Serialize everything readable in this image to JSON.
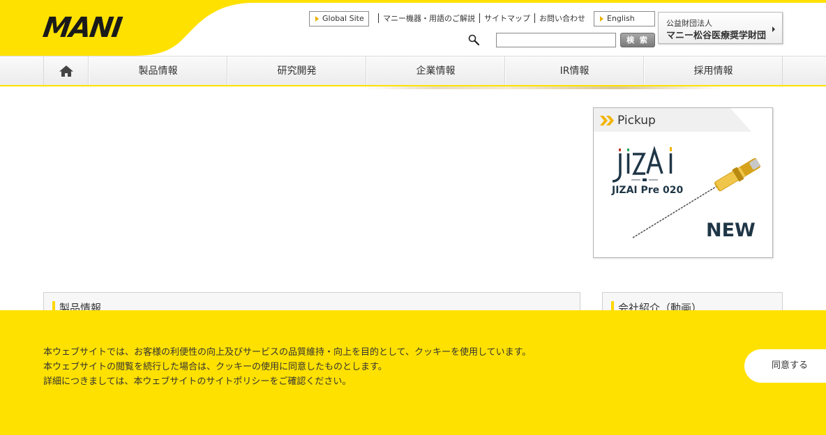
{
  "header": {
    "logo_text": "MANI",
    "global_site_label": "Global Site",
    "english_label": "English",
    "util_links": [
      "マニー機器・用語のご解説",
      "サイトマップ",
      "お問い合わせ"
    ],
    "foundation": {
      "line1": "公益財団法人",
      "line2": "マニー松谷医療奨学財団"
    },
    "search": {
      "value": "",
      "button_label": "検 索"
    }
  },
  "nav": {
    "home_icon": "home-icon",
    "items": [
      "製品情報",
      "研究開発",
      "企業情報",
      "IR情報",
      "採用情報"
    ]
  },
  "pickup": {
    "title": "Pickup",
    "product_name": "JIZAI Pre 020",
    "badge": "NEW"
  },
  "sections": {
    "left_title": "製品情報",
    "right_title": "会社紹介（動画）"
  },
  "cookie": {
    "lines": [
      "本ウェブサイトでは、お客様の利便性の向上及びサービスの品質維持・向上を目的として、クッキーを使用しています。",
      "本ウェブサイトの閲覧を続行した場合は、クッキーの使用に同意したものとします。",
      "詳細につきましては、本ウェブサイトのサイトポリシーをご確認ください。"
    ],
    "agree_label": "同意する"
  },
  "colors": {
    "brand_yellow": "#ffe100",
    "dark_navy": "#1f3646"
  }
}
